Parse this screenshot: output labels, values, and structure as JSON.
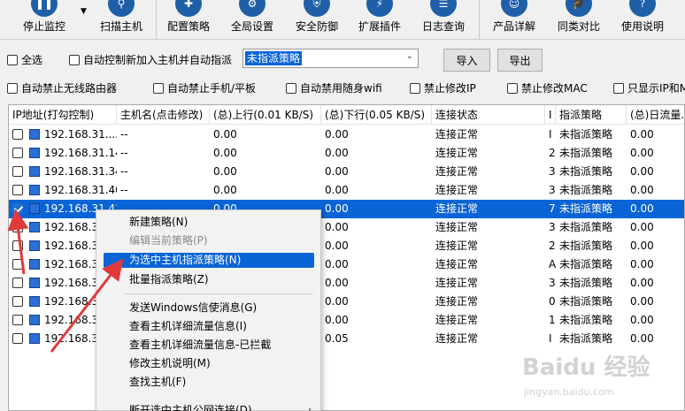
{
  "toolbar": {
    "items": [
      {
        "label": "停止监控",
        "icon": "pause-icon"
      },
      {
        "label": "扫描主机",
        "icon": "search-icon"
      },
      {
        "label": "配置策略",
        "icon": "puzzle-icon"
      },
      {
        "label": "全局设置",
        "icon": "gear-icon"
      },
      {
        "label": "安全防御",
        "icon": "shield-icon"
      },
      {
        "label": "扩展插件",
        "icon": "plugin-icon"
      },
      {
        "label": "日志查询",
        "icon": "log-icon"
      },
      {
        "label": "产品详解",
        "icon": "person-icon"
      },
      {
        "label": "同类对比",
        "icon": "graduation-icon"
      },
      {
        "label": "使用说明",
        "icon": "help-icon"
      }
    ]
  },
  "filters": {
    "select_all": "全选",
    "auto_assign": "自动控制新加入主机并自动指派",
    "policy_select": "未指派策略",
    "import": "导入",
    "export": "导出",
    "block_router": "自动禁止无线路由器",
    "block_mobile": "自动禁止手机/平板",
    "block_wifi": "自动禁用随身wifi",
    "block_ip": "禁止修改IP",
    "block_mac": "禁止修改MAC",
    "show_ip_mac": "只显示IP和M"
  },
  "table": {
    "headers": [
      "IP地址(打勾控制)",
      "主机名(点击修改)",
      "(总)上行(0.01 KB/S)",
      "(总)下行(0.05 KB/S)",
      "连接状态",
      "I",
      "指派策略",
      "(总)日流量..."
    ],
    "rows": [
      {
        "ip": "192.168.31....",
        "host": "--",
        "up": "0.00",
        "down": "0.00",
        "status": "连接正常",
        "col6": "I",
        "policy": "未指派策略",
        "daily": "0.00",
        "checked": false
      },
      {
        "ip": "192.168.31.14",
        "host": "--",
        "up": "0.00",
        "down": "0.00",
        "status": "连接正常",
        "col6": "2",
        "policy": "未指派策略",
        "daily": "0.00",
        "checked": false
      },
      {
        "ip": "192.168.31.34",
        "host": "--",
        "up": "0.00",
        "down": "0.00",
        "status": "连接正常",
        "col6": "3",
        "policy": "未指派策略",
        "daily": "0.00",
        "checked": false
      },
      {
        "ip": "192.168.31.40",
        "host": "--",
        "up": "0.00",
        "down": "0.00",
        "status": "连接正常",
        "col6": "3",
        "policy": "未指派策略",
        "daily": "0.00",
        "checked": false
      },
      {
        "ip": "192.168.31.41",
        "host": "",
        "up": "0.00",
        "down": "0.00",
        "status": "连接正常",
        "col6": "7",
        "policy": "未指派策略",
        "daily": "0.00",
        "checked": true
      },
      {
        "ip": "192.168.31",
        "host": "",
        "up": "",
        "down": "0.00",
        "status": "连接正常",
        "col6": "3",
        "policy": "未指派策略",
        "daily": "0.00",
        "checked": false
      },
      {
        "ip": "192.168.31",
        "host": "",
        "up": "",
        "down": "0.00",
        "status": "连接正常",
        "col6": "2",
        "policy": "未指派策略",
        "daily": "0.00",
        "checked": false
      },
      {
        "ip": "192.168.31",
        "host": "",
        "up": "",
        "down": "0.00",
        "status": "连接正常",
        "col6": "A",
        "policy": "未指派策略",
        "daily": "0.00",
        "checked": false
      },
      {
        "ip": "192.168.31",
        "host": "",
        "up": "",
        "down": "0.00",
        "status": "连接正常",
        "col6": "3",
        "policy": "未指派策略",
        "daily": "0.00",
        "checked": false
      },
      {
        "ip": "192.168.31",
        "host": "",
        "up": "",
        "down": "0.00",
        "status": "连接正常",
        "col6": "0",
        "policy": "未指派策略",
        "daily": "0.00",
        "checked": false
      },
      {
        "ip": "192.168.31",
        "host": "",
        "up": "",
        "down": "0.00",
        "status": "连接正常",
        "col6": "1",
        "policy": "未指派策略",
        "daily": "0.00",
        "checked": false
      },
      {
        "ip": "192.168.31",
        "host": "",
        "up": "",
        "down": "0.05",
        "status": "连接正常",
        "col6": "I",
        "policy": "未指派策略",
        "daily": "0.00",
        "checked": false
      }
    ]
  },
  "context_menu": {
    "items": [
      {
        "label": "新建策略(N)",
        "disabled": false
      },
      {
        "label": "编辑当前策略(P)",
        "disabled": true
      },
      {
        "label": "为选中主机指派策略(N)",
        "disabled": false,
        "highlighted": true
      },
      {
        "label": "批量指派策略(Z)",
        "disabled": false
      },
      {
        "label": "发送Windows信使消息(G)",
        "disabled": false
      },
      {
        "label": "查看主机详细流量信息(I)",
        "disabled": false
      },
      {
        "label": "查看主机详细流量信息-已拦截",
        "disabled": false
      },
      {
        "label": "修改主机说明(M)",
        "disabled": false
      },
      {
        "label": "查找主机(F)",
        "disabled": false
      },
      {
        "label": "断开选中主机公网连接(D)",
        "disabled": false
      }
    ]
  },
  "watermark": {
    "text": "Baidu 经验",
    "sub": "jingyan.baidu.com"
  },
  "colors": {
    "selection": "#0a64d6",
    "annotation_arrow": "#e23a3a",
    "toolbar_icon": "#1f5fa8"
  }
}
